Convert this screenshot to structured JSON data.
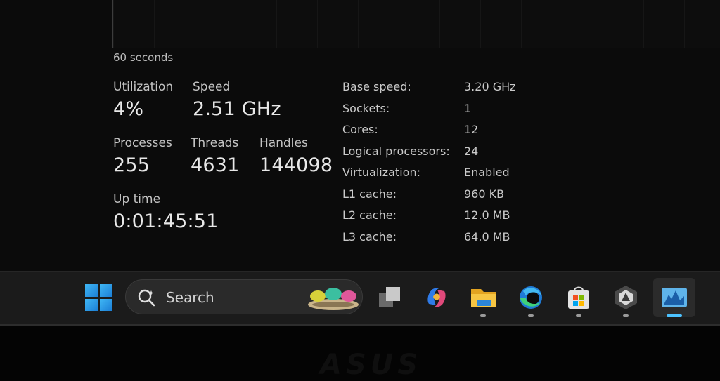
{
  "graph": {
    "axis_label": "60 seconds"
  },
  "stats": {
    "utilization": {
      "label": "Utilization",
      "value": "4%"
    },
    "speed": {
      "label": "Speed",
      "value": "2.51 GHz"
    },
    "processes": {
      "label": "Processes",
      "value": "255"
    },
    "threads": {
      "label": "Threads",
      "value": "4631"
    },
    "handles": {
      "label": "Handles",
      "value": "144098"
    },
    "uptime": {
      "label": "Up time",
      "value": "0:01:45:51"
    }
  },
  "specs": [
    {
      "label": "Base speed:",
      "value": "3.20 GHz"
    },
    {
      "label": "Sockets:",
      "value": "1"
    },
    {
      "label": "Cores:",
      "value": "12"
    },
    {
      "label": "Logical processors:",
      "value": "24"
    },
    {
      "label": "Virtualization:",
      "value": "Enabled"
    },
    {
      "label": "L1 cache:",
      "value": "960 KB"
    },
    {
      "label": "L2 cache:",
      "value": "12.0 MB"
    },
    {
      "label": "L3 cache:",
      "value": "64.0 MB"
    }
  ],
  "taskbar": {
    "search_label": "Search",
    "icons": [
      "windows-start-icon",
      "search-icon",
      "task-view-icon",
      "copilot-icon",
      "file-explorer-icon",
      "edge-icon",
      "store-icon",
      "app-icon",
      "task-manager-icon"
    ],
    "accent": "#4cc2ff"
  },
  "bezel": {
    "brand": "ASUS"
  }
}
